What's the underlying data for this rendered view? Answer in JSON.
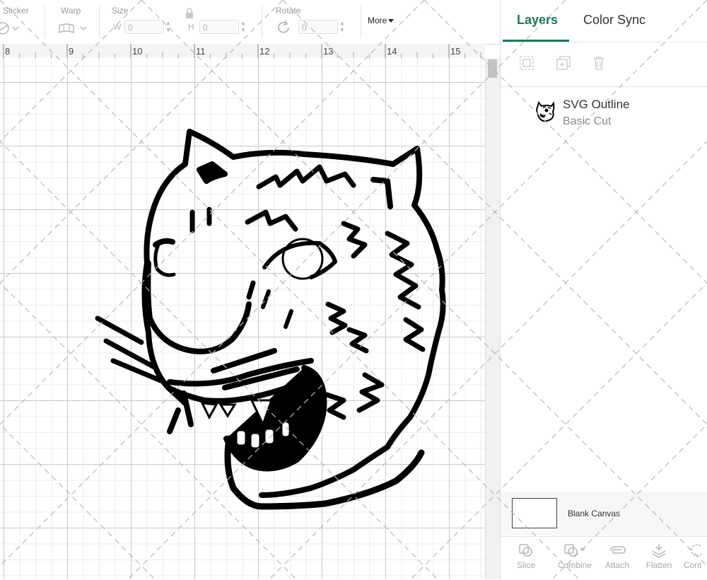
{
  "toolbar": {
    "sticker_label": "Sticker",
    "warp_label": "Warp",
    "size_label": "Size",
    "size_w_axis": "W",
    "size_w_value": "0",
    "size_h_axis": "H",
    "size_h_value": "0",
    "rotate_label": "Rotate",
    "rotate_value": "0",
    "more_label": "More"
  },
  "ruler": {
    "ticks": [
      "8",
      "9",
      "10",
      "11",
      "12",
      "13",
      "14",
      "15"
    ]
  },
  "panel": {
    "tabs": [
      {
        "label": "Layers",
        "active": true
      },
      {
        "label": "Color Sync",
        "active": false
      }
    ],
    "layers": [
      {
        "name": "SVG Outline",
        "operation": "Basic Cut"
      }
    ],
    "blank_canvas_label": "Blank Canvas",
    "bottom_tools": [
      "Slice",
      "Combine",
      "Attach",
      "Flatten",
      "Cont"
    ]
  },
  "colors": {
    "accent": "#1b7a55",
    "artwork": "#000000",
    "grid_major": "#c9c9c9",
    "grid_minor": "#ececec"
  },
  "icons": {
    "sticker": "sticker-icon",
    "warp": "warp-icon",
    "lock": "lock-icon",
    "rotate": "rotate-icon",
    "group": "group-icon",
    "duplicate": "duplicate-icon",
    "delete": "trash-icon",
    "slice": "slice-icon",
    "combine": "combine-icon",
    "attach": "attach-icon",
    "flatten": "flatten-icon"
  }
}
